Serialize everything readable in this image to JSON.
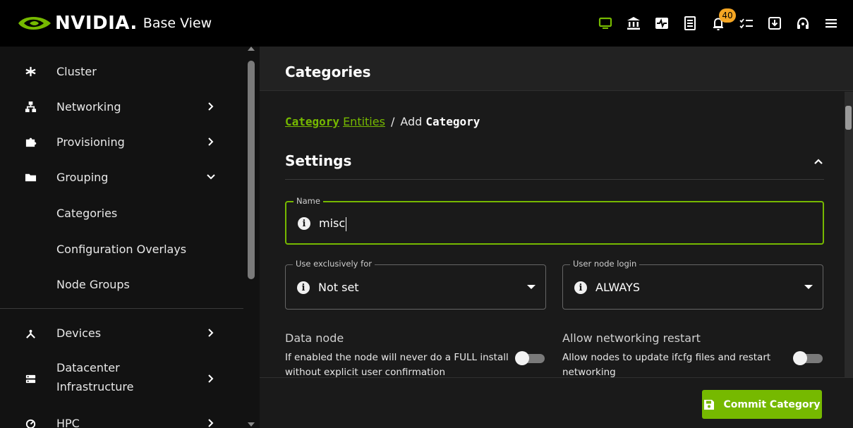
{
  "brand": {
    "wordmark": "NVIDIA.",
    "product": "Base View"
  },
  "topbar": {
    "icons": [
      "monitor-icon",
      "bank-icon",
      "health-icon",
      "log-icon",
      "bell-icon",
      "tasks-icon",
      "download-icon",
      "support-icon",
      "menu-icon"
    ],
    "notification_count": "40",
    "active_color": "#76b900"
  },
  "sidebar": {
    "items": [
      {
        "label": "Cluster",
        "icon": "cluster-icon"
      },
      {
        "label": "Networking",
        "icon": "network-icon"
      },
      {
        "label": "Provisioning",
        "icon": "puzzle-icon"
      },
      {
        "label": "Grouping",
        "icon": "folder-icon"
      }
    ],
    "grouping_children": [
      "Categories",
      "Configuration Overlays",
      "Node Groups"
    ],
    "lower_items": [
      {
        "label": "Devices",
        "icon": "devices-icon"
      },
      {
        "label_line1": "Datacenter",
        "label_line2": "Infrastructure",
        "icon": "rack-icon"
      },
      {
        "label": "HPC",
        "icon": "hpc-icon"
      }
    ]
  },
  "page": {
    "title": "Categories"
  },
  "breadcrumb": {
    "category": "Category",
    "entities": "Entities",
    "separator": "/",
    "add": "Add",
    "category2": "Category"
  },
  "settings": {
    "title": "Settings",
    "name": {
      "legend": "Name",
      "value": "misc"
    },
    "use_exclusively": {
      "legend": "Use exclusively for",
      "value": "Not set"
    },
    "user_node_login": {
      "legend": "User node login",
      "value": "ALWAYS"
    },
    "data_node": {
      "title": "Data node",
      "desc": "If enabled the node will never do a FULL install without explicit user confirmation",
      "enabled": false
    },
    "allow_net_restart": {
      "title": "Allow networking restart",
      "desc": "Allow nodes to update ifcfg files and restart networking",
      "enabled": false
    }
  },
  "footer": {
    "commit_label": "Commit Category",
    "accent": "#76b900"
  }
}
